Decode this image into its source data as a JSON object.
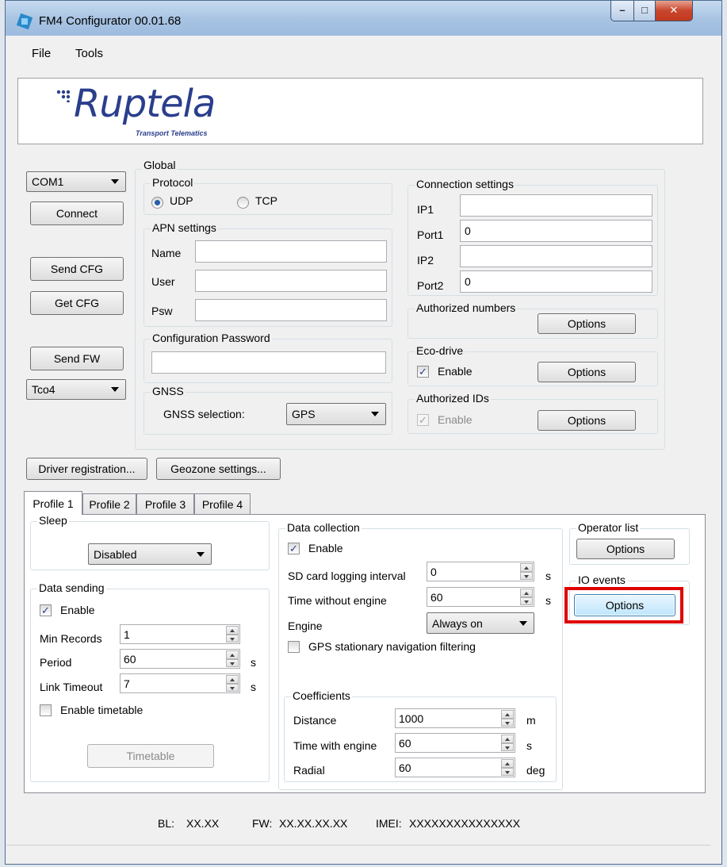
{
  "window": {
    "title": "FM4 Configurator 00.01.68",
    "min": "–",
    "max": "□",
    "close": "✕"
  },
  "menu": {
    "file": "File",
    "tools": "Tools"
  },
  "logo": {
    "brand": "Ruptela",
    "tagline": "Transport Telematics"
  },
  "left": {
    "com_port": "COM1",
    "connect": "Connect",
    "send_cfg": "Send CFG",
    "get_cfg": "Get CFG",
    "send_fw": "Send FW",
    "tco": "Tco4"
  },
  "global": {
    "legend": "Global",
    "protocol": {
      "legend": "Protocol",
      "udp": "UDP",
      "tcp": "TCP",
      "selected": "UDP"
    },
    "apn": {
      "legend": "APN settings",
      "name_label": "Name",
      "user_label": "User",
      "psw_label": "Psw",
      "name": "",
      "user": "",
      "psw": ""
    },
    "config_password": {
      "legend": "Configuration Password",
      "value": ""
    },
    "gnss": {
      "legend": "GNSS",
      "label": "GNSS selection:",
      "value": "GPS"
    },
    "connection": {
      "legend": "Connection settings",
      "ip1_label": "IP1",
      "port1_label": "Port1",
      "ip2_label": "IP2",
      "port2_label": "Port2",
      "ip1": "",
      "port1": "0",
      "ip2": "",
      "port2": "0"
    },
    "authorized_numbers": {
      "legend": "Authorized numbers",
      "options": "Options"
    },
    "eco_drive": {
      "legend": "Eco-drive",
      "enable": "Enable",
      "checked": true,
      "options": "Options"
    },
    "authorized_ids": {
      "legend": "Authorized IDs",
      "enable": "Enable",
      "checked": true,
      "options": "Options"
    }
  },
  "buttons": {
    "driver_registration": "Driver registration...",
    "geozone_settings": "Geozone settings..."
  },
  "tabs": [
    {
      "label": "Profile 1",
      "active": true
    },
    {
      "label": "Profile 2"
    },
    {
      "label": "Profile 3"
    },
    {
      "label": "Profile 4"
    }
  ],
  "profile": {
    "sleep": {
      "legend": "Sleep",
      "value": "Disabled"
    },
    "data_sending": {
      "legend": "Data sending",
      "enable": "Enable",
      "min_records_label": "Min Records",
      "min_records": "1",
      "period_label": "Period",
      "period": "60",
      "period_unit": "s",
      "link_timeout_label": "Link Timeout",
      "link_timeout": "7",
      "link_timeout_unit": "s",
      "enable_timetable": "Enable timetable",
      "timetable": "Timetable"
    },
    "data_collection": {
      "legend": "Data collection",
      "enable": "Enable",
      "sd_label": "SD card logging interval",
      "sd": "0",
      "sd_unit": "s",
      "twe_label": "Time without engine",
      "twe": "60",
      "twe_unit": "s",
      "engine_label": "Engine",
      "engine": "Always on",
      "gps_filter": "GPS stationary navigation filtering"
    },
    "coefficients": {
      "legend": "Coefficients",
      "distance_label": "Distance",
      "distance": "1000",
      "distance_unit": "m",
      "twe_label": "Time with engine",
      "twe": "60",
      "twe_unit": "s",
      "radial_label": "Radial",
      "radial": "60",
      "radial_unit": "deg"
    },
    "operator_list": {
      "legend": "Operator list",
      "options": "Options"
    },
    "io_events": {
      "legend": "IO events",
      "options": "Options"
    }
  },
  "footer": {
    "bl_label": "BL:",
    "bl": "XX.XX",
    "fw_label": "FW:",
    "fw": "XX.XX.XX.XX",
    "imei_label": "IMEI:",
    "imei": "XXXXXXXXXXXXXXX"
  },
  "colors": {
    "highlight": "#e00000",
    "title_gradient": "#a9c4e3",
    "brand": "#2a3e8c"
  }
}
